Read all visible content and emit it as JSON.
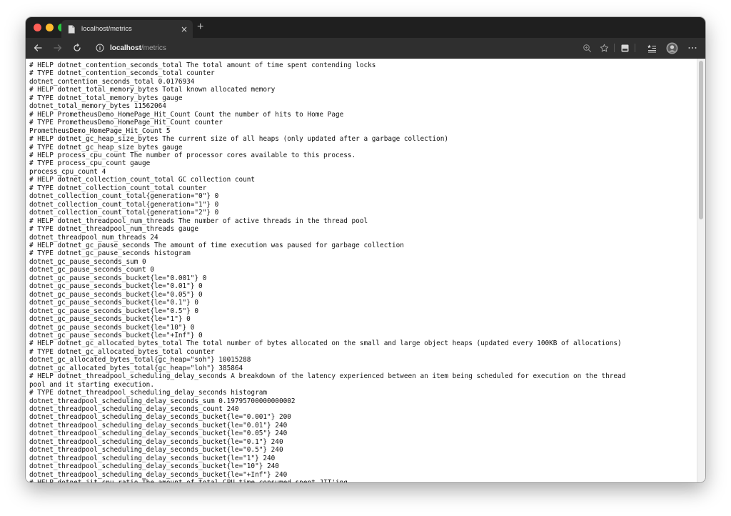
{
  "browser": {
    "tab_title": "localhost/metrics",
    "tab_close": "×",
    "new_tab": "+",
    "address_host": "localhost",
    "address_path": "/metrics"
  },
  "scrollbar": {
    "position_fraction": 0.0,
    "visible_fraction": 0.35
  },
  "metrics_text": "# HELP dotnet_contention_seconds_total The total amount of time spent contending locks\n# TYPE dotnet_contention_seconds_total counter\ndotnet_contention_seconds_total 0.0176934\n# HELP dotnet_total_memory_bytes Total known allocated memory\n# TYPE dotnet_total_memory_bytes gauge\ndotnet_total_memory_bytes 11562064\n# HELP PrometheusDemo_HomePage_Hit_Count Count the number of hits to Home Page\n# TYPE PrometheusDemo_HomePage_Hit_Count counter\nPrometheusDemo_HomePage_Hit_Count 5\n# HELP dotnet_gc_heap_size_bytes The current size of all heaps (only updated after a garbage collection)\n# TYPE dotnet_gc_heap_size_bytes gauge\n# HELP process_cpu_count The number of processor cores available to this process.\n# TYPE process_cpu_count gauge\nprocess_cpu_count 4\n# HELP dotnet_collection_count_total GC collection count\n# TYPE dotnet_collection_count_total counter\ndotnet_collection_count_total{generation=\"0\"} 0\ndotnet_collection_count_total{generation=\"1\"} 0\ndotnet_collection_count_total{generation=\"2\"} 0\n# HELP dotnet_threadpool_num_threads The number of active threads in the thread pool\n# TYPE dotnet_threadpool_num_threads gauge\ndotnet_threadpool_num_threads 24\n# HELP dotnet_gc_pause_seconds The amount of time execution was paused for garbage collection\n# TYPE dotnet_gc_pause_seconds histogram\ndotnet_gc_pause_seconds_sum 0\ndotnet_gc_pause_seconds_count 0\ndotnet_gc_pause_seconds_bucket{le=\"0.001\"} 0\ndotnet_gc_pause_seconds_bucket{le=\"0.01\"} 0\ndotnet_gc_pause_seconds_bucket{le=\"0.05\"} 0\ndotnet_gc_pause_seconds_bucket{le=\"0.1\"} 0\ndotnet_gc_pause_seconds_bucket{le=\"0.5\"} 0\ndotnet_gc_pause_seconds_bucket{le=\"1\"} 0\ndotnet_gc_pause_seconds_bucket{le=\"10\"} 0\ndotnet_gc_pause_seconds_bucket{le=\"+Inf\"} 0\n# HELP dotnet_gc_allocated_bytes_total The total number of bytes allocated on the small and large object heaps (updated every 100KB of allocations)\n# TYPE dotnet_gc_allocated_bytes_total counter\ndotnet_gc_allocated_bytes_total{gc_heap=\"soh\"} 10015288\ndotnet_gc_allocated_bytes_total{gc_heap=\"loh\"} 385864\n# HELP dotnet_threadpool_scheduling_delay_seconds A breakdown of the latency experienced between an item being scheduled for execution on the thread\npool and it starting execution.\n# TYPE dotnet_threadpool_scheduling_delay_seconds histogram\ndotnet_threadpool_scheduling_delay_seconds_sum 0.19795700000000002\ndotnet_threadpool_scheduling_delay_seconds_count 240\ndotnet_threadpool_scheduling_delay_seconds_bucket{le=\"0.001\"} 200\ndotnet_threadpool_scheduling_delay_seconds_bucket{le=\"0.01\"} 240\ndotnet_threadpool_scheduling_delay_seconds_bucket{le=\"0.05\"} 240\ndotnet_threadpool_scheduling_delay_seconds_bucket{le=\"0.1\"} 240\ndotnet_threadpool_scheduling_delay_seconds_bucket{le=\"0.5\"} 240\ndotnet_threadpool_scheduling_delay_seconds_bucket{le=\"1\"} 240\ndotnet_threadpool_scheduling_delay_seconds_bucket{le=\"10\"} 240\ndotnet_threadpool_scheduling_delay_seconds_bucket{le=\"+Inf\"} 240\n# HELP dotnet_jit_cpu_ratio The amount of total CPU time consumed spent JIT'ing"
}
